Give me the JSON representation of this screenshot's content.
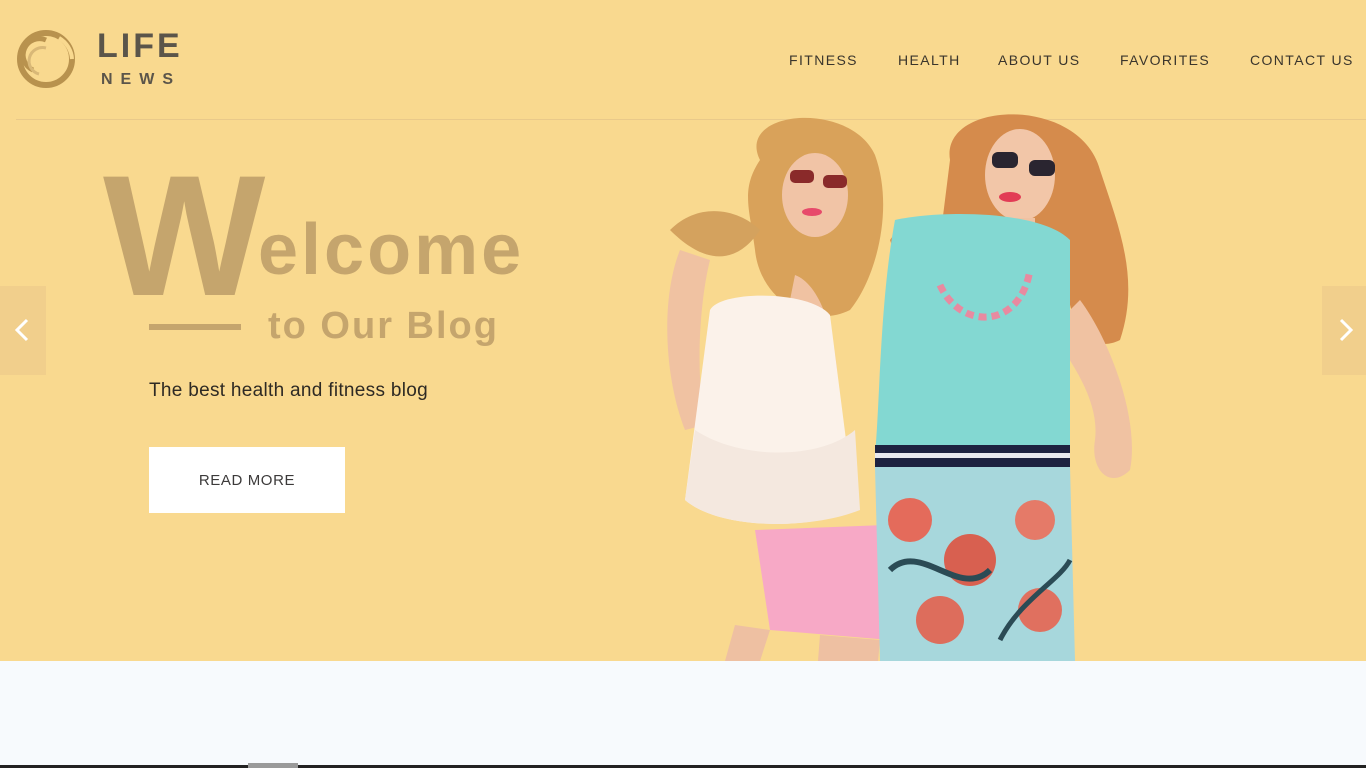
{
  "brand": {
    "line1": "LIFE",
    "line2": "NEWS"
  },
  "nav": {
    "fitness": "FITNESS",
    "health": "HEALTH",
    "about": "ABOUT US",
    "favorites": "FAVORITES",
    "contact": "CONTACT US"
  },
  "hero": {
    "big_letter": "W",
    "big_rest": "elcome",
    "subtitle": "to Our Blog",
    "tagline": "The best health and fitness blog",
    "button": "READ MORE"
  },
  "colors": {
    "hero_bg": "#f9d98f",
    "accent": "#c5a56d",
    "logo_gold": "#b8924e",
    "page_bg": "#f7fafd"
  },
  "icons": {
    "prev": "chevron-left-icon",
    "next": "chevron-right-icon",
    "logo": "swirl-logo-icon"
  }
}
